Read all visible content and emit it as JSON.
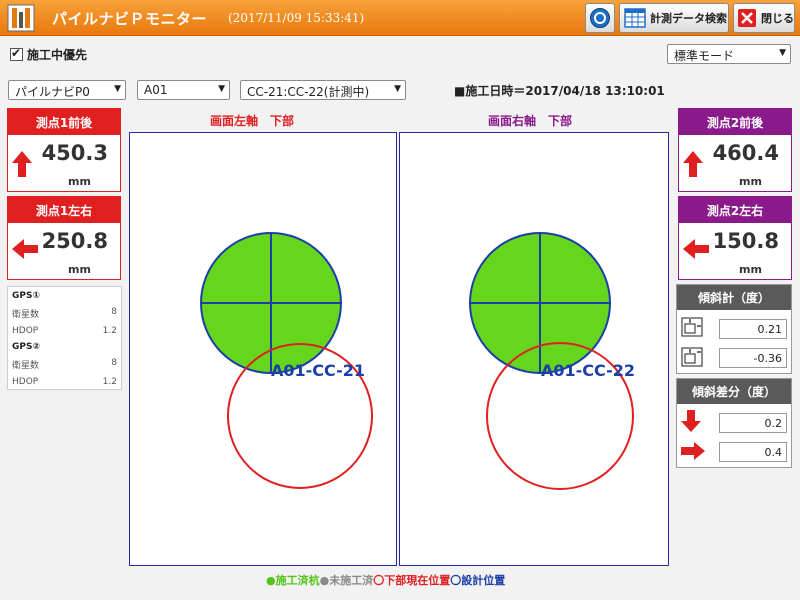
{
  "header": {
    "title": "パイルナビＰモニター",
    "datetime": "(2017/11/09 15:33:41)",
    "search_label": "計測データ検索",
    "close_label": "閉じる"
  },
  "options": {
    "priority_checkbox_label": "施工中優先",
    "mode_select_value": "標準モード",
    "device_select_value": "パイルナビP0",
    "pile_group_select_value": "A01",
    "pile_select_value": "CC-21:CC-22(計測中)",
    "exec_time": "■施工日時＝2017/04/18 13:10:01"
  },
  "point1": {
    "front_back": {
      "title": "測点1前後",
      "value": "450.3",
      "unit": "mm"
    },
    "left_right": {
      "title": "測点1左右",
      "value": "250.8",
      "unit": "mm"
    }
  },
  "point2": {
    "front_back": {
      "title": "測点2前後",
      "value": "460.4",
      "unit": "mm"
    },
    "left_right": {
      "title": "測点2左右",
      "value": "150.8",
      "unit": "mm"
    }
  },
  "gps": {
    "gps1": {
      "title": "GPS①",
      "satellites_label": "衛星数",
      "satellites": "8",
      "hdop_label": "HDOP",
      "hdop": "1.2"
    },
    "gps2": {
      "title": "GPS②",
      "satellites_label": "衛星数",
      "satellites": "8",
      "hdop_label": "HDOP",
      "hdop": "1.2"
    }
  },
  "plots": {
    "left": {
      "title": "画面左軸　下部",
      "pile_label": "A01-CC-21"
    },
    "right": {
      "title": "画面右軸　下部",
      "pile_label": "A01-CC-22"
    }
  },
  "inclinometer": {
    "title": "傾斜計（度）",
    "value1": "0.21",
    "value2": "-0.36"
  },
  "inclination_diff": {
    "title": "傾斜差分（度）",
    "value1": "0.2",
    "value2": "0.4"
  },
  "legend": {
    "done": "●施工済杭",
    "not_done": "●未施工済",
    "current": "〇下部現在位置",
    "design": "〇設計位置"
  },
  "colors": {
    "titlebar": "#ef8a1f",
    "point1_accent": "#e02020",
    "point2_accent": "#8a1a8a",
    "pile_fill": "#66d61c",
    "pile_outline": "#1c3ea8",
    "current_position": "#e02020"
  },
  "icons": {
    "app": "pile-navi-app-icon",
    "circle_button": "target-circle-icon",
    "search": "calendar-grid-icon",
    "close": "close-x-icon"
  }
}
